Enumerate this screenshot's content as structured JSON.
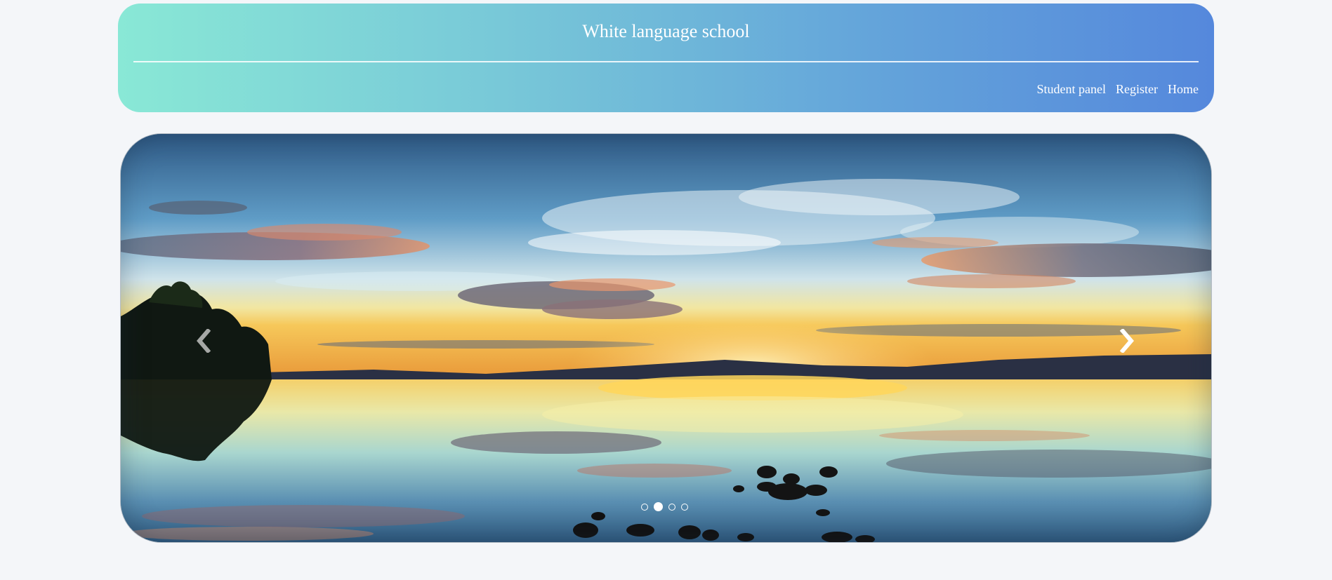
{
  "header": {
    "title": "White language school",
    "nav": [
      {
        "label": "Student panel"
      },
      {
        "label": "Register"
      },
      {
        "label": "Home"
      }
    ]
  },
  "carousel": {
    "image": "sunset-lake-reflection",
    "prev_icon": "chevron-left-icon",
    "next_icon": "chevron-right-icon",
    "slide_count": 4,
    "active_slide": 2
  },
  "colors": {
    "background": "#f4f6f9",
    "header_gradient_start": "#89e8d6",
    "header_gradient_end": "#5588dc",
    "header_text": "#ffffff"
  }
}
